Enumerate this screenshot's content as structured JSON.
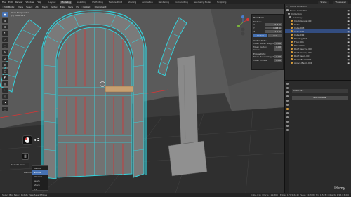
{
  "topbar": {
    "menu": [
      "File",
      "Edit",
      "Render",
      "Window",
      "Help"
    ],
    "tabs": [
      "Layout",
      "Modeling",
      "Sculpting",
      "UV Editing",
      "Texture Paint",
      "Shading",
      "Animation",
      "Rendering",
      "Compositing",
      "Geometry Nodes",
      "Scripting"
    ],
    "active_tab": "Modeling",
    "scene": "Scene",
    "view_layer": "ViewLayer"
  },
  "header": {
    "mode": "Edit Mode",
    "items": [
      "View",
      "Select",
      "Add",
      "Mesh",
      "Vertex",
      "Edge",
      "Face",
      "UV"
    ],
    "orientation": "Global",
    "snap": "Increment"
  },
  "viewport": {
    "view_label": "User Perspective",
    "object_label": "(1) Cube.011"
  },
  "npanel": {
    "title": "Transform",
    "median_label": "Median:",
    "rows": [
      {
        "label": "X",
        "value": "0.2 m"
      },
      {
        "label": "Y",
        "value": "0.08 m"
      },
      {
        "label": "Z",
        "value": "1.1 m"
      }
    ],
    "buttons": [
      "Global",
      "Local"
    ],
    "sections": [
      {
        "title": "Vertex Data:",
        "fields": [
          "Mean Bevel Weight",
          "Mean Vertex Crease"
        ]
      },
      {
        "title": "Edges Data:",
        "fields": [
          "Mean Bevel Weight",
          "Mean Crease"
        ]
      }
    ],
    "values": [
      "0.00",
      "0.00",
      "0.00",
      "0.00"
    ]
  },
  "keyoverlay": {
    "count": "x 2",
    "pause": "II"
  },
  "operator": {
    "title": "Select Linked",
    "delimit_label": "Delimit",
    "menu_title": "Delimit",
    "options": [
      "Normal",
      "Material",
      "Seam",
      "Sharp",
      "UV"
    ],
    "selected": "Normal"
  },
  "outliner": {
    "search_placeholder": "Scene Collection",
    "items": [
      {
        "name": "Scene Collection",
        "color": "#9a9a9a",
        "sel": false
      },
      {
        "name": "Collection",
        "color": "#9a9a9a",
        "sel": false
      },
      {
        "name": "Gateway",
        "color": "#9a9a9a",
        "sel": false
      },
      {
        "name": "Clock Gasket.001",
        "color": "#d49a3a",
        "sel": false
      },
      {
        "name": "Cube",
        "color": "#d49a3a",
        "sel": false
      },
      {
        "name": "Cube.003",
        "color": "#d49a3a",
        "sel": false
      },
      {
        "name": "Cube.011",
        "color": "#d49a3a",
        "sel": true
      },
      {
        "name": "Cube.012",
        "color": "#d49a3a",
        "sel": false
      },
      {
        "name": "Doorleg.001",
        "color": "#d49a3a",
        "sel": false
      },
      {
        "name": "Floor.001",
        "color": "#d49a3a",
        "sel": false
      },
      {
        "name": "Plane.001",
        "color": "#d49a3a",
        "sel": false
      },
      {
        "name": "Roof Bearing.001",
        "color": "#d49a3a",
        "sel": false
      },
      {
        "name": "Roof Bearing.002",
        "color": "#d49a3a",
        "sel": false
      },
      {
        "name": "Roof Beam.001",
        "color": "#d49a3a",
        "sel": false
      },
      {
        "name": "Room Beam.001",
        "color": "#d49a3a",
        "sel": false
      },
      {
        "name": "Above Beam.001",
        "color": "#d49a3a",
        "sel": false
      }
    ]
  },
  "properties": {
    "object_name": "Cube.011",
    "add_modifier": "Add Modifier"
  },
  "status": {
    "left": "Select   Box Select   Rotate View   Select   Move",
    "right": "Cube.011 | Verts 119/860 | Edges 174/1,622 | Faces 72/768 | Tris 1,528 | Objects 1/16 | 3.2.0"
  },
  "watermark": "Udemy",
  "colors": {
    "accent": "#4772b3",
    "edge_cyan": "#35d2dc",
    "seam_red": "#e03131"
  }
}
